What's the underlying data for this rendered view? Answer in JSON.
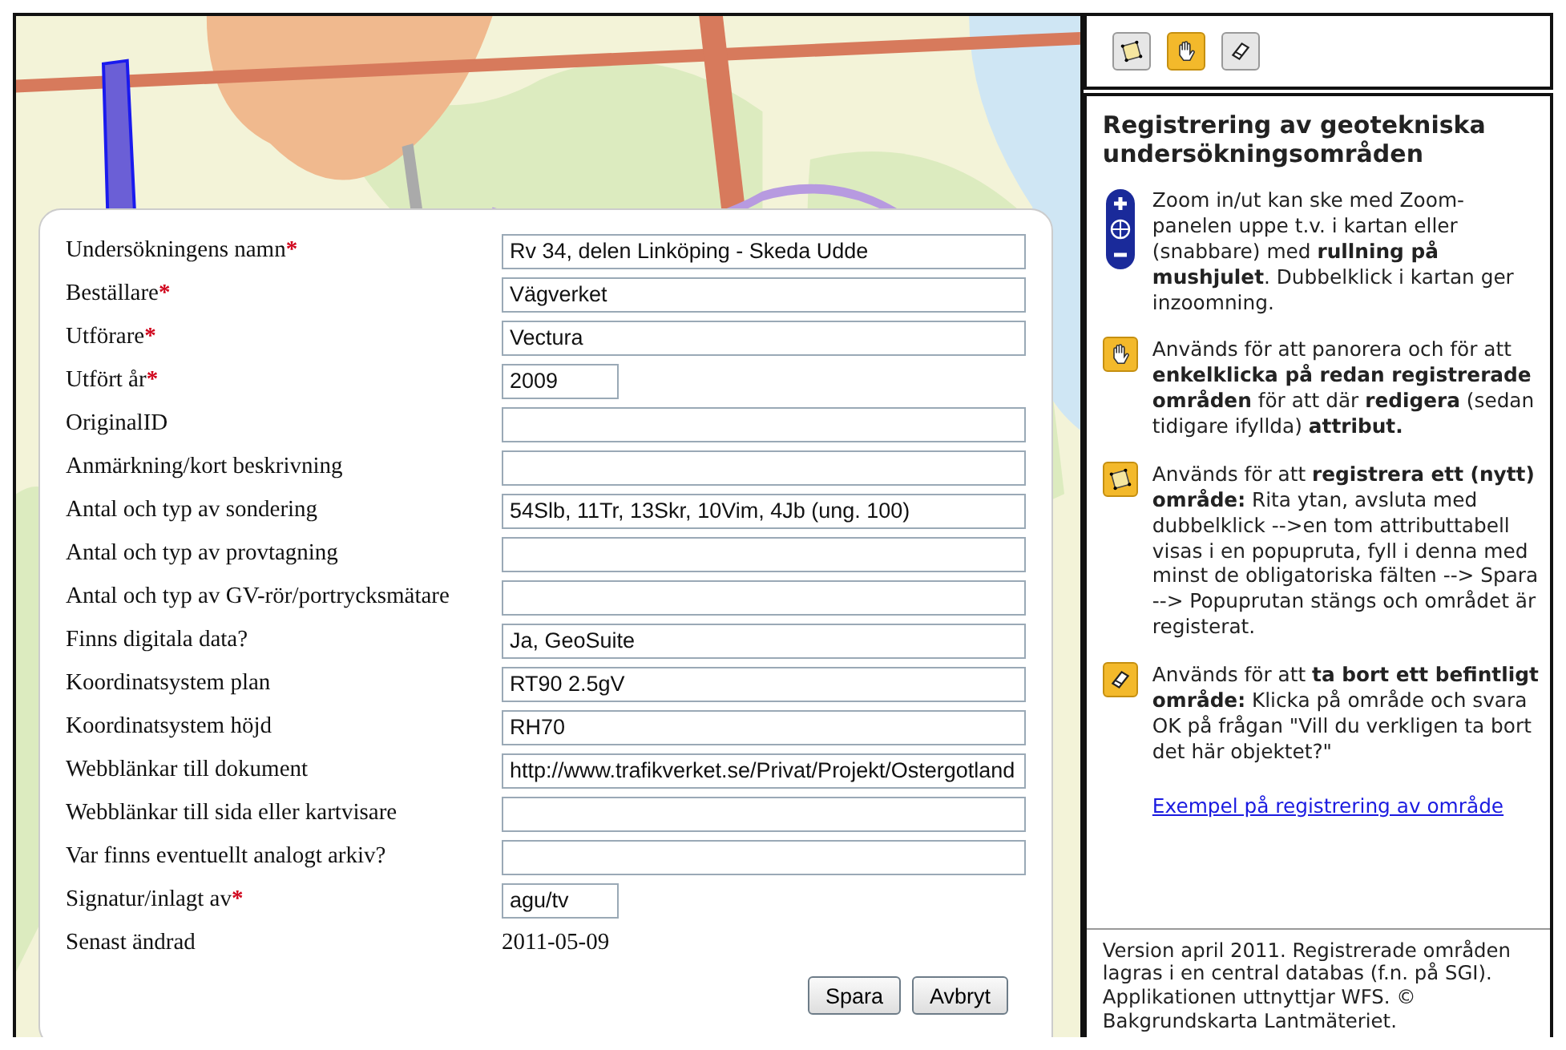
{
  "form": {
    "fields": [
      {
        "label": "Undersökningens namn",
        "required": true,
        "kind": "wide",
        "value": "Rv 34, delen Linköping - Skeda Udde"
      },
      {
        "label": "Beställare",
        "required": true,
        "kind": "wide",
        "value": "Vägverket"
      },
      {
        "label": "Utförare",
        "required": true,
        "kind": "wide",
        "value": "Vectura"
      },
      {
        "label": "Utfört år",
        "required": true,
        "kind": "short",
        "value": "2009"
      },
      {
        "label": "OriginalID",
        "required": false,
        "kind": "wide"
      },
      {
        "label": "Anmärkning/kort beskrivning",
        "required": false,
        "kind": "wide"
      },
      {
        "label": "Antal och typ av sondering",
        "required": false,
        "kind": "wide",
        "value": "54Slb, 11Tr, 13Skr, 10Vim, 4Jb (ung. 100)"
      },
      {
        "label": "Antal och typ av provtagning",
        "required": false,
        "kind": "wide"
      },
      {
        "label": "Antal och typ av GV-rör/portrycksmätare",
        "required": false,
        "kind": "wide"
      },
      {
        "label": "Finns digitala data?",
        "required": false,
        "kind": "wide",
        "value": "Ja, GeoSuite"
      },
      {
        "label": "Koordinatsystem plan",
        "required": false,
        "kind": "wide",
        "value": "RT90 2.5gV"
      },
      {
        "label": "Koordinatsystem höjd",
        "required": false,
        "kind": "wide",
        "value": "RH70"
      },
      {
        "label": "Webblänkar till dokument",
        "required": false,
        "kind": "wide",
        "value": "http://www.trafikverket.se/Privat/Projekt/Ostergotland"
      },
      {
        "label": "Webblänkar till sida eller kartvisare",
        "required": false,
        "kind": "wide"
      },
      {
        "label": "Var finns eventuellt analogt arkiv?",
        "required": false,
        "kind": "wide"
      },
      {
        "label": "Signatur/inlagt av",
        "required": true,
        "kind": "short",
        "value": "agu/tv"
      },
      {
        "label": "Senast ändrad",
        "required": false,
        "kind": "static",
        "value": "2011-05-09"
      }
    ],
    "required_mark": "*",
    "buttons": [
      "Spara",
      "Avbryt"
    ]
  },
  "toolbar": {
    "tools": [
      {
        "kind": "polygon",
        "selected": false
      },
      {
        "kind": "hand",
        "selected": true
      },
      {
        "kind": "eraser",
        "selected": false
      }
    ]
  },
  "info": {
    "title": "Registrering av geotekniska undersökningsområden",
    "sections": [
      {
        "kind": "zoom",
        "text": "Zoom in/ut kan ske med Zoom-panelen uppe t.v. i kartan eller (snabbare) med **rullning på mushjulet**. Dubbelklick i kartan ger inzoomning."
      },
      {
        "kind": "hand",
        "text": "Används för att panorera och för att **enkelklicka på redan registrerade områden** för att där **redigera** (sedan tidigare ifyllda) **attribut.**"
      },
      {
        "kind": "polygon",
        "text": "Används för att **registrera ett (nytt) område:** Rita ytan, avsluta med dubbelklick -->en tom attributtabell visas i en popupruta, fyll i denna med minst de obligatoriska fälten --> Spara --> Popuprutan stängs och området är registerat."
      },
      {
        "kind": "eraser",
        "text": "Används för att **ta bort ett befintligt område:** Klicka på område och svara OK på frågan \"Vill du verkligen ta bort det här objektet?\""
      }
    ],
    "link": "Exempel på registrering av område",
    "footer": "Version april 2011. Registrerade områden lagras i en central databas (f.n. på SGI). Applikationen uttnyttjar WFS. © Bakgrundskarta Lantmäteriet."
  }
}
